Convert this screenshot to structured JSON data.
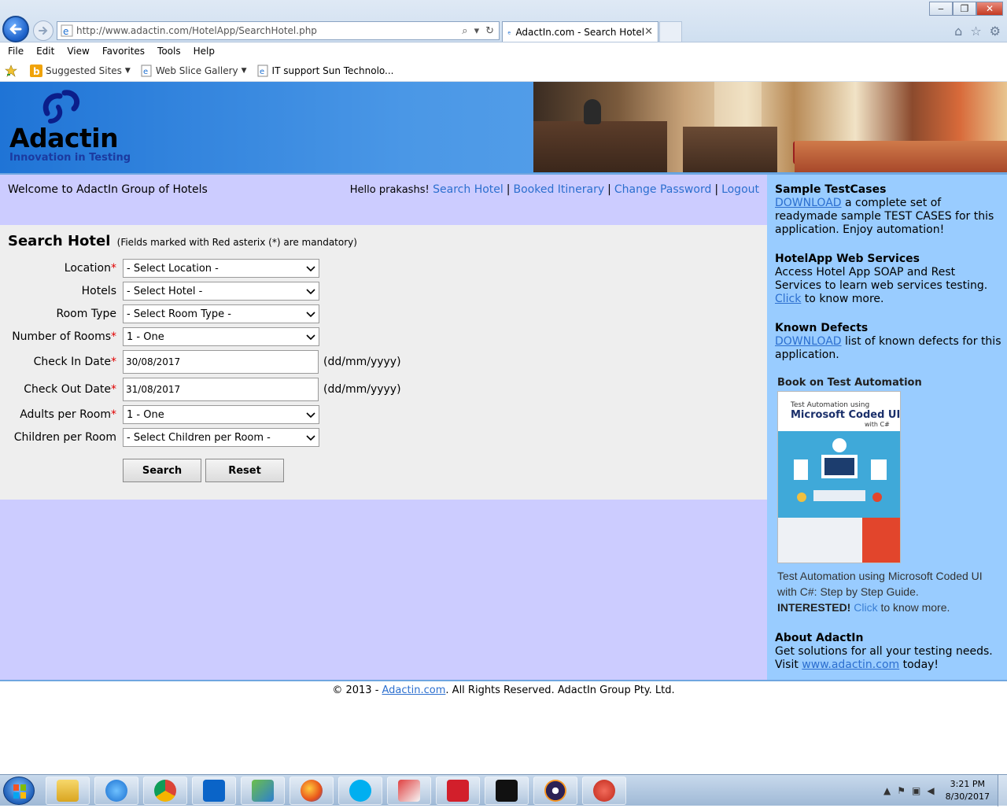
{
  "browser": {
    "url_host": "http://www.adactin.com",
    "url_path": "/HotelApp/SearchHotel.php",
    "tab_title": "AdactIn.com - Search Hotel",
    "menu": [
      "File",
      "Edit",
      "View",
      "Favorites",
      "Tools",
      "Help"
    ],
    "favorites": [
      {
        "label": "Suggested Sites",
        "icon": "bing-icon",
        "dropdown": true
      },
      {
        "label": "Web Slice Gallery",
        "icon": "ie-page-icon",
        "dropdown": true
      },
      {
        "label": "IT support  Sun Technolo...",
        "icon": "ie-page-icon",
        "dropdown": false
      }
    ]
  },
  "header": {
    "logo_name": "Adactin",
    "logo_tagline": "Innovation in Testing"
  },
  "topbar": {
    "welcome": "Welcome to AdactIn Group of Hotels",
    "hello": "Hello prakashs!",
    "links": [
      "Search Hotel",
      "Booked Itinerary",
      "Change Password",
      "Logout"
    ]
  },
  "form": {
    "title": "Search Hotel",
    "note": "(Fields marked with Red asterix (*) are mandatory)",
    "fields": {
      "location": {
        "label": "Location",
        "value": "- Select Location -"
      },
      "hotels": {
        "label": "Hotels",
        "value": "- Select Hotel -"
      },
      "room_type": {
        "label": "Room Type",
        "value": "- Select Room Type -"
      },
      "rooms": {
        "label": "Number of Rooms",
        "value": "1 - One"
      },
      "checkin": {
        "label": "Check In Date",
        "value": "30/08/2017"
      },
      "checkout": {
        "label": "Check Out Date",
        "value": "31/08/2017"
      },
      "adults": {
        "label": "Adults per Room",
        "value": "1 - One"
      },
      "children": {
        "label": "Children per Room",
        "value": "- Select Children per Room -"
      }
    },
    "date_format": "(dd/mm/yyyy)",
    "asterisk": "*",
    "search_label": "Search",
    "reset_label": "Reset"
  },
  "sidebar": {
    "testcases_title": "Sample TestCases",
    "testcases_link": "DOWNLOAD",
    "testcases_text": " a complete set of readymade sample TEST CASES for this application. Enjoy automation!",
    "ws_title": "HotelApp Web Services",
    "ws_text": "Access Hotel App SOAP and Rest Services to learn web services testing. ",
    "ws_link": "Click",
    "ws_text2": " to know more.",
    "defects_title": "Known Defects",
    "defects_link": "DOWNLOAD",
    "defects_text": " list of known defects for this application.",
    "book_title": "Book on Test Automation",
    "book_cover_line1": "Test Automation using",
    "book_cover_line2": "Microsoft Coded UI",
    "book_cover_line3": "with C#",
    "book_desc": "Test Automation using Microsoft Coded UI with C#: Step by Step Guide.",
    "book_interested": "INTERESTED!",
    "book_click": "Click",
    "book_more": " to know more.",
    "about_title": "About AdactIn",
    "about_text": "Get solutions for all your testing needs. Visit ",
    "about_link": "www.adactin.com",
    "about_text2": " today!"
  },
  "footer": {
    "prefix": "© 2013 - ",
    "link": "Adactin.com",
    "suffix": ". All Rights Reserved. AdactIn Group Pty. Ltd."
  },
  "taskbar": {
    "apps": [
      "file-explorer-icon",
      "internet-explorer-icon",
      "chrome-icon",
      "outlook-icon",
      "network-app-icon",
      "firefox-icon",
      "skype-icon",
      "snipping-tool-icon",
      "rsa-icon",
      "command-prompt-icon",
      "eclipse-icon",
      "error-icon"
    ],
    "time": "3:21 PM",
    "date": "8/30/2017"
  },
  "colors": {
    "page_bg": "#ccccff",
    "sidebar_bg": "#99ccff",
    "form_bg": "#eeeeee",
    "link": "#2c6fcf",
    "required": "#e00000"
  }
}
